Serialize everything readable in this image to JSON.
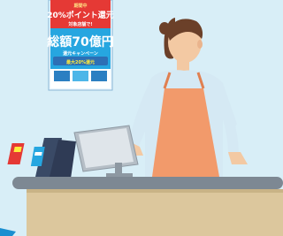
{
  "poster": {
    "top_small": "期間中",
    "headline": "20%ポイント還元",
    "sub_line": "対象店舗で!",
    "amount_label": "総額70億円",
    "campaign_line": "還元キャンペーン",
    "bottom_tag": "最大20%還元"
  },
  "scene": {
    "description_colors": {
      "background": "#d8eef7",
      "counter_top": "#7d8893",
      "counter_front": "#dcc79d",
      "apron": "#f29a6b",
      "shirt": "#d5e9f4",
      "poster_blue": "#1a8fd0",
      "poster_red": "#e53935"
    }
  }
}
